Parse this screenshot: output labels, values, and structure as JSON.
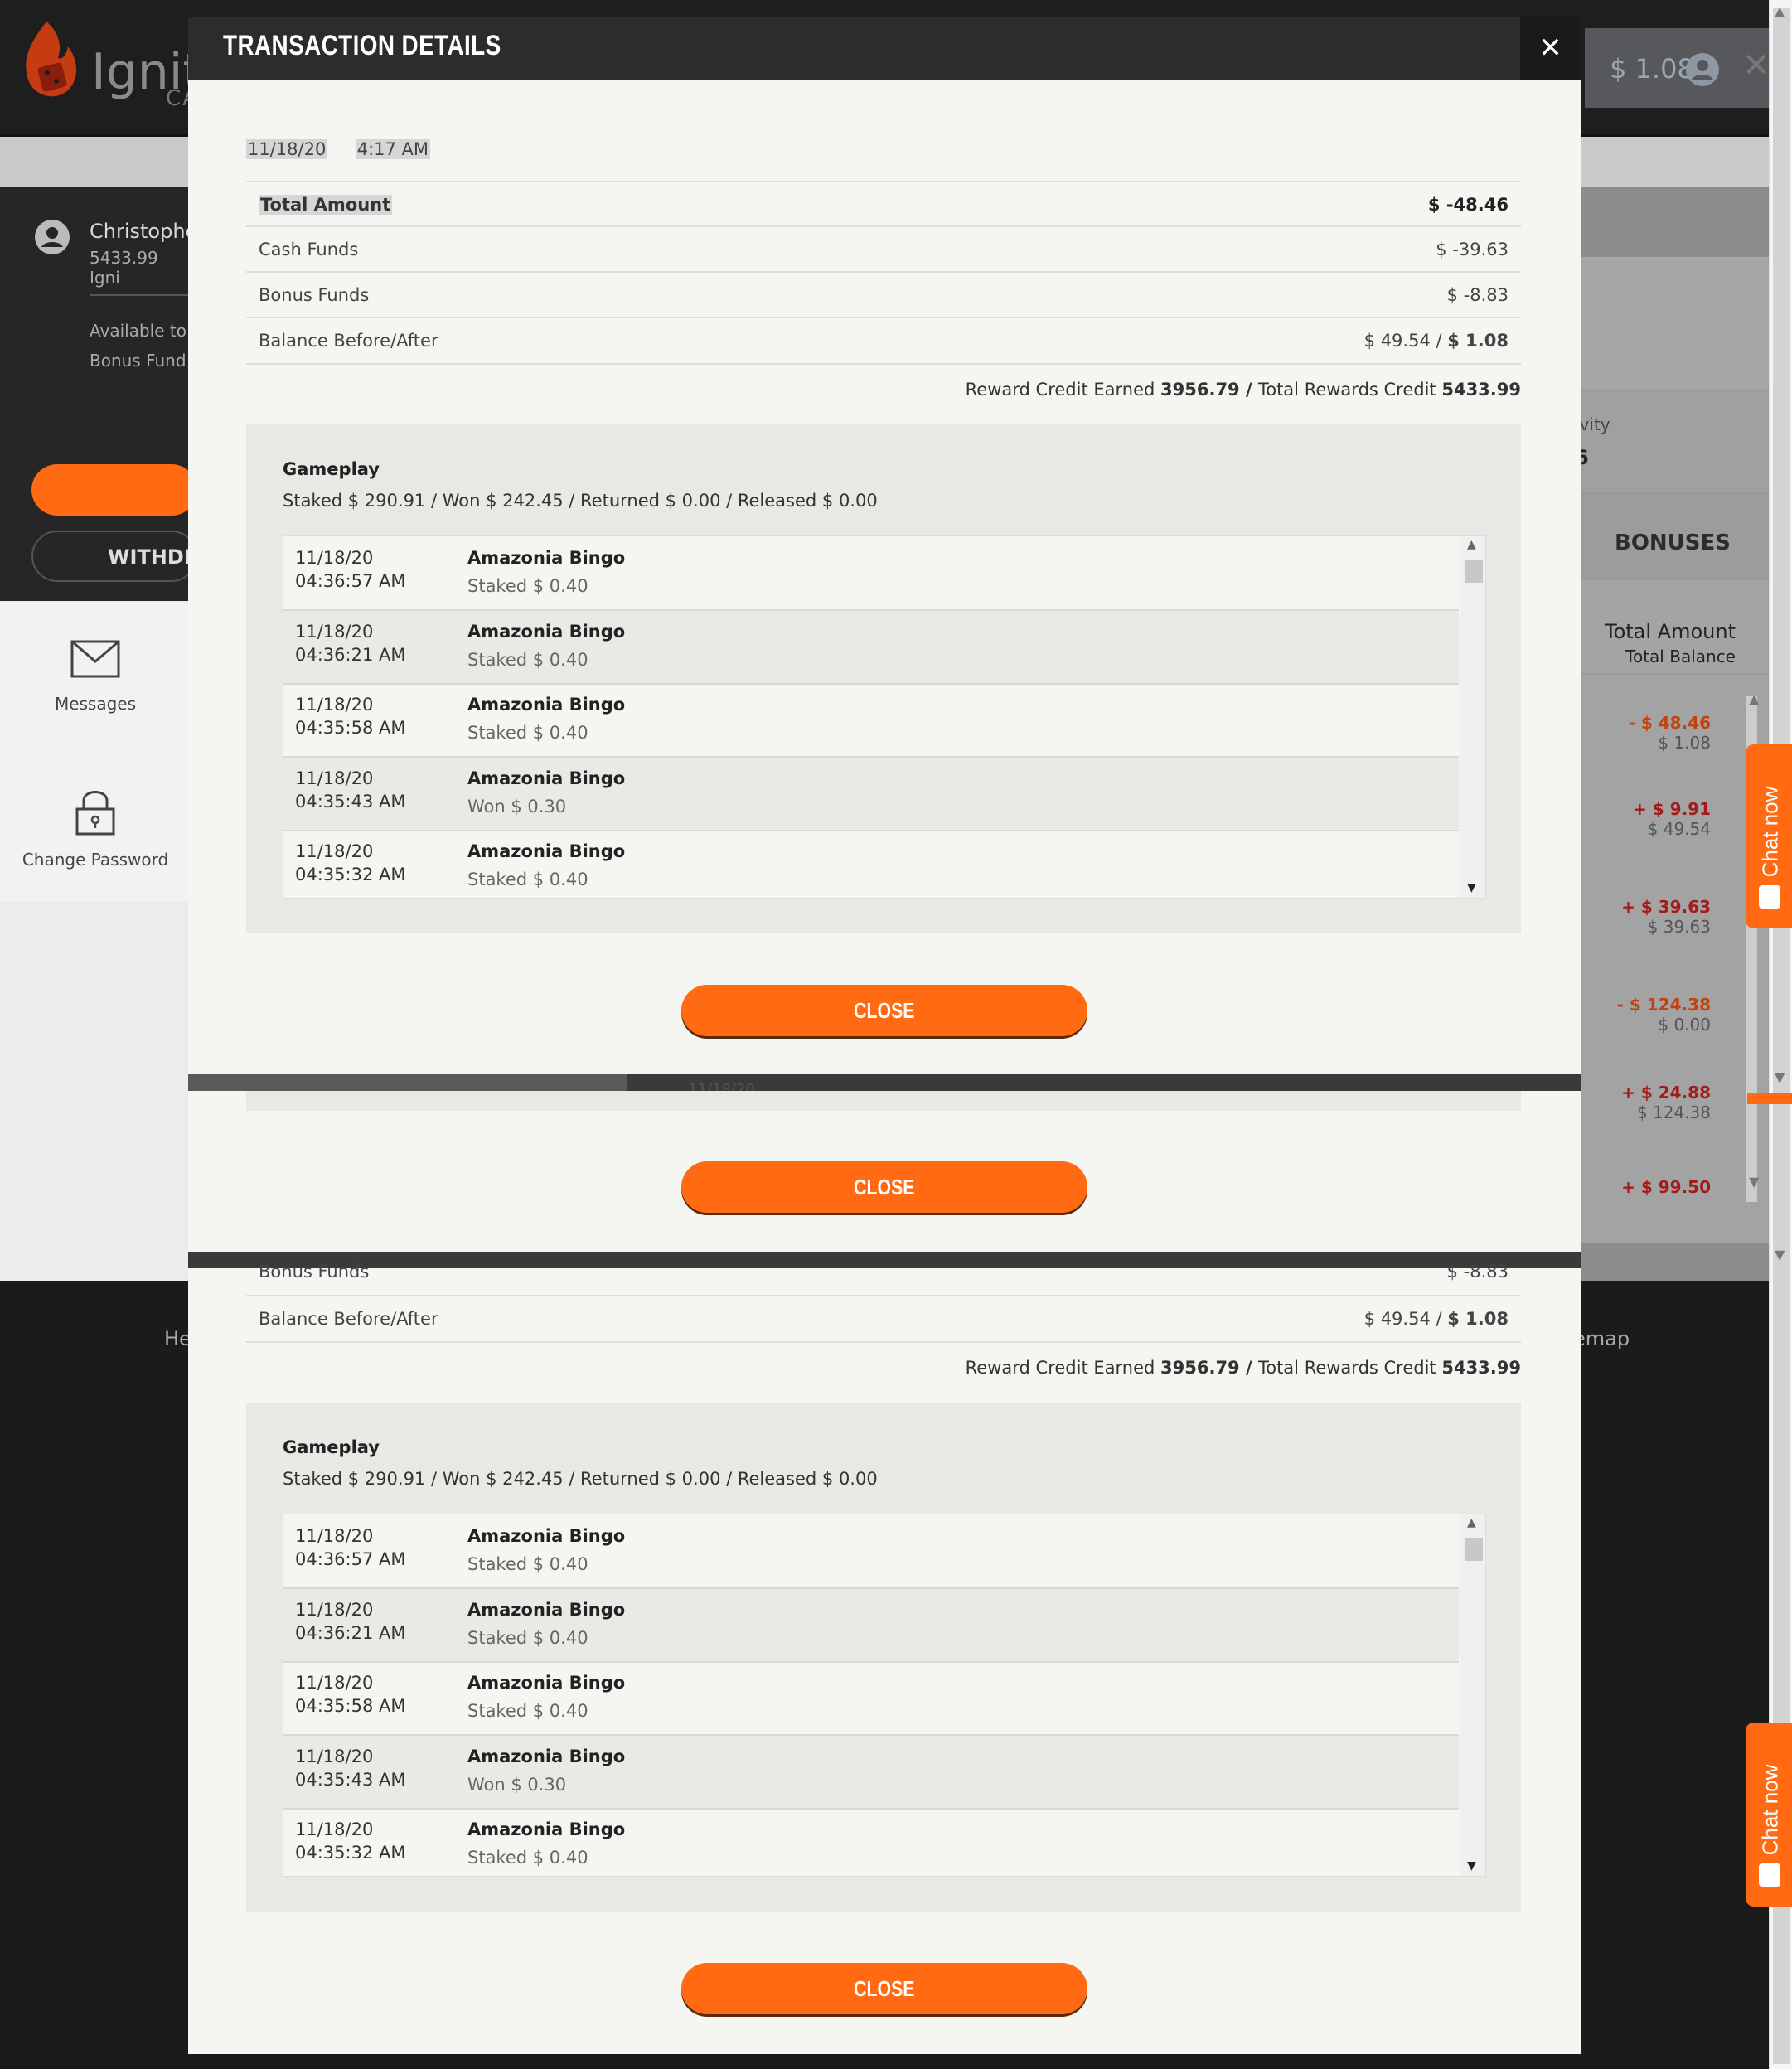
{
  "site": {
    "logo_text": "Igniti",
    "logo_sub": "CA",
    "header_balance": "$ 1.08",
    "close_glyph": "✕"
  },
  "account": {
    "user_name": "Christophe",
    "points": "5433.99 Igni",
    "available": "Available to",
    "bonus_funds": "Bonus Fund",
    "withdraw_label": "WITHDRA"
  },
  "sidenav": {
    "messages": "Messages",
    "change_password": "Change Password"
  },
  "background": {
    "activity_label": "ivity",
    "activity_value": "6",
    "bonuses_tab": "BONUSES",
    "total_amount_header": "Total Amount",
    "total_balance_header": "Total Balance",
    "peek_date": "11/18/20",
    "rows": [
      {
        "amount": "- $ 48.46",
        "balance": "$ 1.08",
        "color": "#c2410c"
      },
      {
        "amount": "+ $ 9.91",
        "balance": "$ 49.54",
        "color": "#a11d1d"
      },
      {
        "amount": "+ $ 39.63",
        "balance": "$ 39.63",
        "color": "#a11d1d"
      },
      {
        "amount": "- $ 124.38",
        "balance": "$ 0.00",
        "color": "#c2410c"
      },
      {
        "amount": "+ $ 24.88",
        "balance": "$ 124.38",
        "color": "#a11d1d"
      },
      {
        "amount": "+ $ 99.50",
        "balance": "",
        "color": "#a11d1d"
      }
    ]
  },
  "footer": {
    "left_link": "He",
    "right_link": "emap"
  },
  "chat": {
    "label": "Chat now"
  },
  "modal": {
    "title": "TRANSACTION DETAILS",
    "close_icon": "✕",
    "date": "11/18/20",
    "time": "4:17 AM",
    "total_amount_label": "Total Amount",
    "total_amount_value": "$ -48.46",
    "cash_funds_label": "Cash Funds",
    "cash_funds_value": "$ -39.63",
    "bonus_funds_label": "Bonus Funds",
    "bonus_funds_value": "$ -8.83",
    "balance_label": "Balance Before/After",
    "balance_before": "$ 49.54 / ",
    "balance_after": "$ 1.08",
    "reward_earned_label": "Reward Credit Earned ",
    "reward_earned_value": "3956.79",
    "reward_sep": " / ",
    "reward_total_label": "Total Rewards Credit ",
    "reward_total_value": "5433.99",
    "gameplay_title": "Gameplay",
    "gameplay_summary": "Staked $ 290.91 / Won $ 242.45 / Returned $ 0.00 / Released $ 0.00",
    "close_button": "CLOSE",
    "entries": [
      {
        "date": "11/18/20",
        "time": "04:36:57 AM",
        "game": "Amazonia Bingo",
        "detail": "Staked $ 0.40"
      },
      {
        "date": "11/18/20",
        "time": "04:36:21 AM",
        "game": "Amazonia Bingo",
        "detail": "Staked $ 0.40"
      },
      {
        "date": "11/18/20",
        "time": "04:35:58 AM",
        "game": "Amazonia Bingo",
        "detail": "Staked $ 0.40"
      },
      {
        "date": "11/18/20",
        "time": "04:35:43 AM",
        "game": "Amazonia Bingo",
        "detail": "Won $ 0.30"
      },
      {
        "date": "11/18/20",
        "time": "04:35:32 AM",
        "game": "Amazonia Bingo",
        "detail": "Staked $ 0.40"
      }
    ]
  },
  "colors": {
    "accent": "#ff6a13",
    "header_dark": "#2c2c2c",
    "modal_bg": "#f5f5f2"
  }
}
